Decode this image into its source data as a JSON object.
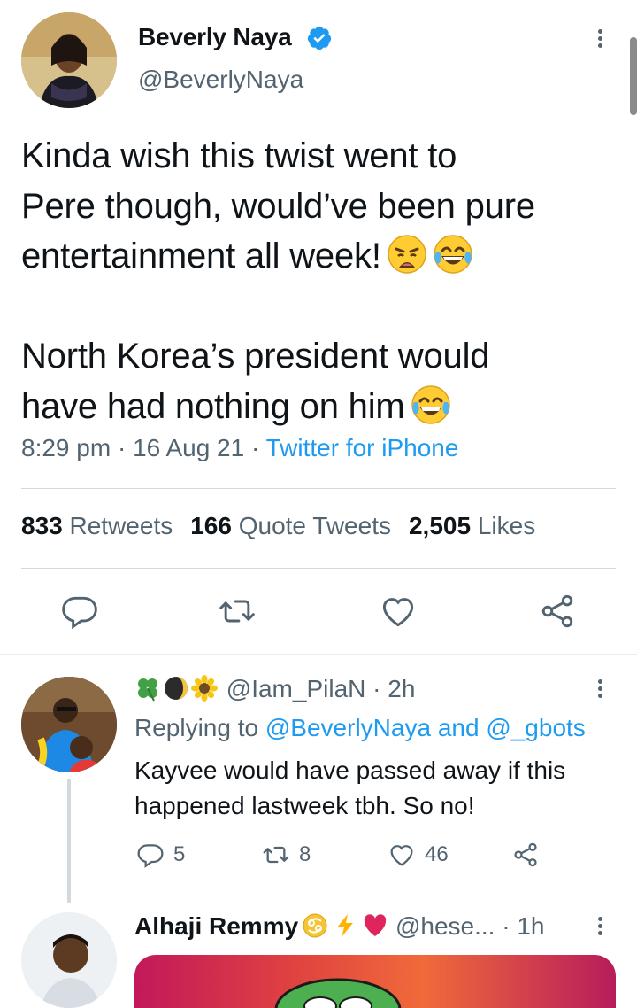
{
  "tweet": {
    "author_name": "Beverly Naya",
    "author_handle": "@BeverlyNaya",
    "text_line1": "Kinda wish this twist went to",
    "text_line2": "Pere though, would’ve been pure",
    "text_line3": "entertainment all week!",
    "text_line4": "North Korea’s president would",
    "text_line5": "have had nothing on him",
    "time": "8:29 pm",
    "date": "16 Aug 21",
    "client": "Twitter for iPhone",
    "sep": "·",
    "retweets_count": "833",
    "retweets_label": "Retweets",
    "quotes_count": "166",
    "quotes_label": "Quote Tweets",
    "likes_count": "2,505",
    "likes_label": "Likes"
  },
  "reply": {
    "handle": "@Iam_PilaN",
    "time": "· 2h",
    "replying_prefix": "Replying to",
    "mention1": "@BeverlyNaya",
    "and_word": "and",
    "mention2": "@_gbots",
    "text": "Kayvee would have passed away if this happened lastweek tbh. So no!",
    "reply_count": "5",
    "retweet_count": "8",
    "like_count": "46"
  },
  "next_reply": {
    "name": "Alhaji Remmy",
    "handle": "@hese...",
    "time": "· 1h"
  },
  "icons": {
    "verified": "verified-badge-icon",
    "reply": "reply-icon",
    "retweet": "retweet-icon",
    "like": "heart-icon",
    "share": "share-icon",
    "more": "more-vertical-icon"
  },
  "colors": {
    "accent": "#1d9bf0",
    "text": "#0f1419",
    "secondary": "#536471",
    "divider": "#cfd9de"
  }
}
